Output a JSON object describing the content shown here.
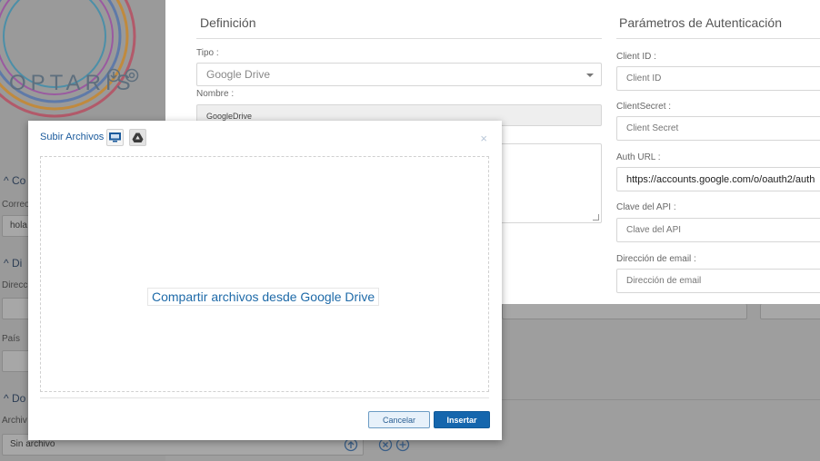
{
  "brand": {
    "logo_text": "OPTARIS"
  },
  "background": {
    "section1_label": "Co",
    "correo_label": "Correo",
    "correo_value": "hola",
    "section2_label": "Di",
    "direccion_label": "Direcc",
    "pais_label": "País",
    "section3_label": "Do",
    "archivo_label": "Archiv",
    "archivo_value": "Sin archivo"
  },
  "definicion": {
    "title": "Definición",
    "tipo_label": "Tipo :",
    "tipo_value": "Google Drive",
    "nombre_label": "Nombre :",
    "nombre_value": "GoogleDrive"
  },
  "auth": {
    "title": "Parámetros de Autenticación",
    "client_id_label": "Client ID :",
    "client_id_placeholder": "Client ID",
    "client_secret_label": "ClientSecret :",
    "client_secret_placeholder": "Client Secret",
    "auth_url_label": "Auth URL :",
    "auth_url_value": "https://accounts.google.com/o/oauth2/auth",
    "api_key_label": "Clave del API :",
    "api_key_placeholder": "Clave del API",
    "email_label": "Dirección de email :",
    "email_placeholder": "Dirección de email"
  },
  "modal": {
    "title": "Subir Archivos",
    "close": "×",
    "drive_link": "Compartir archivos desde Google Drive",
    "cancel_label": "Cancelar",
    "insert_label": "Insertar"
  }
}
